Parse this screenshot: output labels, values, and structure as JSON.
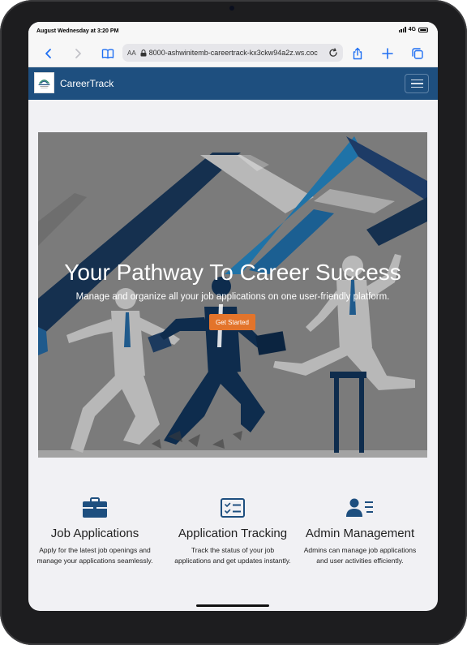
{
  "status": {
    "time": "August Wednesday at 3:20 PM",
    "network": "4G"
  },
  "browser": {
    "text_size_label": "AA",
    "url": "8000-ashwinitemb-careertrack-kx3ckw94a2z.ws.coc",
    "icons": [
      "back-icon",
      "forward-icon",
      "bookmarks-icon",
      "lock-icon",
      "reload-icon",
      "share-icon",
      "new-tab-icon",
      "tabs-icon"
    ],
    "accent": "#1f6ff2"
  },
  "navbar": {
    "brand": "CareerTrack",
    "background": "#1e4f7f"
  },
  "hero": {
    "title": "Your Pathway To Career Success",
    "subtitle": "Manage and organize all your job applications on one user-friendly platform.",
    "cta_label": "Get Started",
    "cta_color": "#e3742b"
  },
  "features": [
    {
      "icon": "briefcase-icon",
      "title": "Job Applications",
      "description": "Apply for the latest job openings and manage your applications seamlessly."
    },
    {
      "icon": "checklist-icon",
      "title": "Application Tracking",
      "description": "Track the status of your job applications and get updates instantly."
    },
    {
      "icon": "user-list-icon",
      "title": "Admin Management",
      "description": "Admins can manage job applications and user activities efficiently."
    }
  ],
  "feature_icon_color": "#1e4f7f"
}
